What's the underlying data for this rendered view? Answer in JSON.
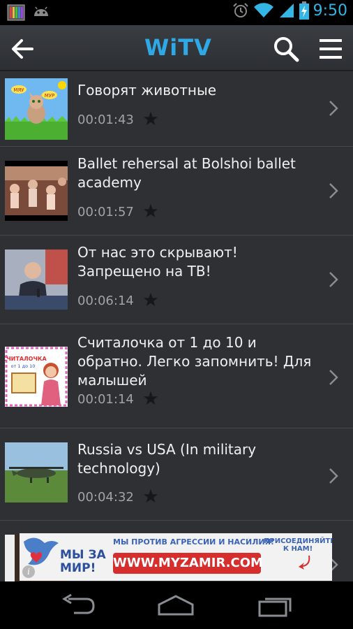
{
  "status_bar": {
    "time": "9:50",
    "left_icons": [
      "app-notification-icon",
      "android-icon"
    ],
    "right_icons": [
      "alarm-icon",
      "wifi-icon",
      "signal-icon",
      "battery-charging-icon"
    ]
  },
  "app_bar": {
    "logo": "WiTV",
    "actions": [
      "back-arrow-icon",
      "search-icon",
      "menu-icon"
    ]
  },
  "videos": [
    {
      "title": "Говорят животные",
      "duration": "00:01:43"
    },
    {
      "title": "Ballet rehersal at Bolshoi ballet academy",
      "duration": "00:01:57"
    },
    {
      "title": "От нас это скрывают! Запрещено на ТВ!",
      "duration": "00:06:14"
    },
    {
      "title": "Считалочка от 1 до 10 и обратно. Легко запомнить! Для малышей",
      "duration": "00:01:14"
    },
    {
      "title": "Russia vs USA (In military technology)",
      "duration": "00:04:32"
    }
  ],
  "thumb_labels": {
    "cat_left": "МЯУ",
    "cat_right": "МУР",
    "counting_title": "СЧИТАЛОЧКА",
    "counting_sub": "от 1 до 10"
  },
  "ad": {
    "slogan": "МЫ ПРОТИВ АГРЕССИИ И НАСИЛИЯ!",
    "join": "ПРИСОЕДИНЯЙТЕСЬ К НАМ!",
    "brand_line1": "МЫ ЗА",
    "brand_line2": "МИР!",
    "url": "WWW.MYZAMIR.COM",
    "info": "i"
  },
  "nav_bar": {
    "buttons": [
      "back-icon",
      "home-icon",
      "recents-icon"
    ]
  },
  "colors": {
    "accent": "#33b5e5",
    "logo": "#2fa8e6",
    "list_bg": "#2e3034",
    "ad_red": "#d62d2d"
  }
}
